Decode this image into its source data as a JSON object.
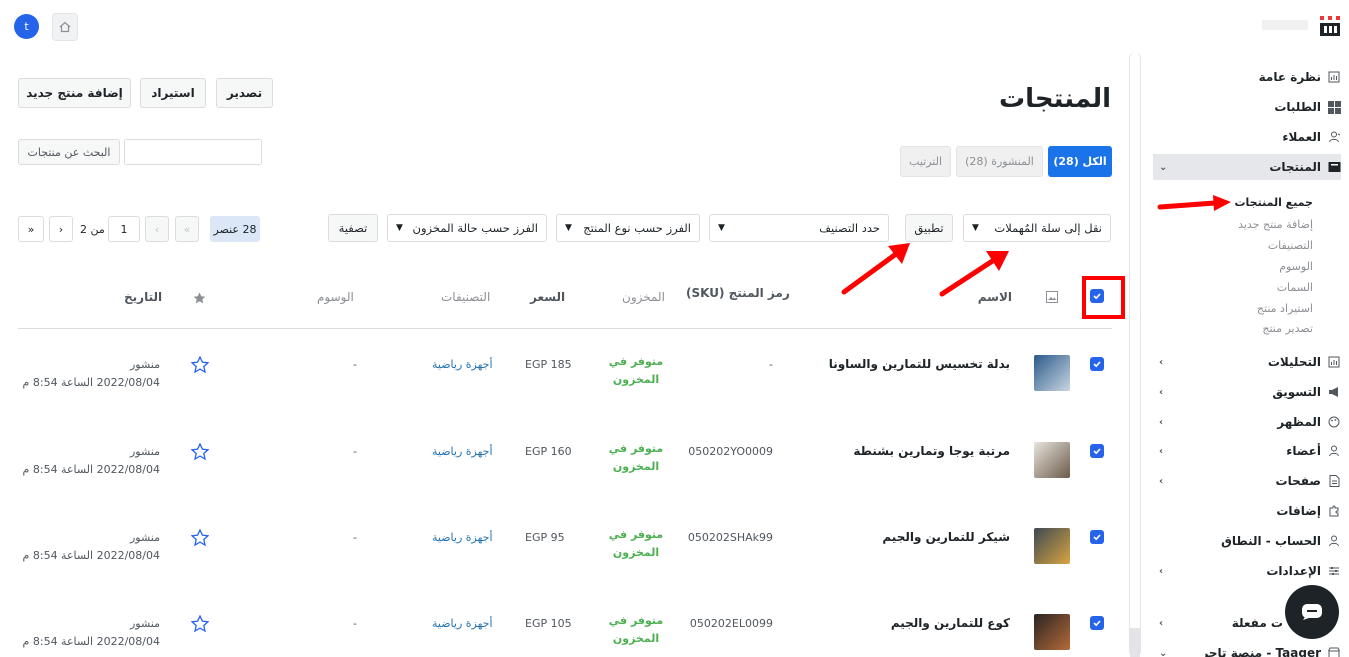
{
  "topbar": {
    "avatar_letter": "t",
    "brand_color": "#2563eb"
  },
  "sidebar": {
    "items": [
      {
        "label": "نظرة عامة",
        "icon": "chart-icon"
      },
      {
        "label": "الطلبات",
        "icon": "grid-icon"
      },
      {
        "label": "العملاء",
        "icon": "users-icon"
      },
      {
        "label": "المنتجات",
        "icon": "box-icon"
      },
      {
        "label": "التحليلات",
        "icon": "chart-icon"
      },
      {
        "label": "التسويق",
        "icon": "megaphone-icon"
      },
      {
        "label": "المظهر",
        "icon": "palette-icon"
      },
      {
        "label": "أعضاء",
        "icon": "users-icon"
      },
      {
        "label": "صفحات",
        "icon": "page-icon"
      },
      {
        "label": "إضافات",
        "icon": "puzzle-icon"
      },
      {
        "label": "الحساب - النطاق",
        "icon": "users-icon"
      },
      {
        "label": "الإعدادات",
        "icon": "sliders-icon"
      },
      {
        "label": "ت مفعلة",
        "icon": "none"
      },
      {
        "label": "Taager - منصة تاجر",
        "icon": "store-icon"
      }
    ],
    "products_submenu": [
      "جميع المنتجات",
      "إضافة منتج جديد",
      "التصنيفات",
      "الوسوم",
      "السمات",
      "استيراد منتج",
      "تصدير منتج"
    ]
  },
  "header": {
    "title": "المنتجات",
    "buttons": {
      "export": "تصدير",
      "import": "استيراد",
      "add_new": "إضافة منتج جديد"
    }
  },
  "tabs": {
    "all": "الكل (28)",
    "published": "المنشورة (28)",
    "sorting": "الترتيب"
  },
  "search": {
    "button": "البحث عن منتجات",
    "value": ""
  },
  "filters": {
    "bulk_action": "نقل إلى سلة المُهملات",
    "apply": "تطبيق",
    "category": "حدد التصنيف",
    "product_type": "الفرز حسب نوع المنتج",
    "stock_status": "الفرز حسب حالة المخزون",
    "filter_button": "تصفية"
  },
  "pagination": {
    "items_count": "28 عنصر",
    "first": "«",
    "prev": "‹",
    "current_page": "1",
    "of_pages": "من 2",
    "next": "›",
    "last": "»"
  },
  "table": {
    "columns": {
      "name": "الاسم",
      "sku": "رمز المنتج (SKU)",
      "stock": "المخزون",
      "price": "السعر",
      "categories": "التصنيفات",
      "tags": "الوسوم",
      "date": "التاريخ"
    },
    "rows": [
      {
        "name": "بدلة تخسيس للتمارين والساونا",
        "sku": "-",
        "stock": "متوفر في المخزون",
        "price": "EGP 185",
        "category": "أجهزة رياضية",
        "tags": "-",
        "status": "منشور",
        "date": "2022/08/04 الساعة 8:54 م"
      },
      {
        "name": "مرتبة يوجا وتمارين بشنطة",
        "sku": "050202YO0009",
        "stock": "متوفر في المخزون",
        "price": "EGP 160",
        "category": "أجهزة رياضية",
        "tags": "-",
        "status": "منشور",
        "date": "2022/08/04 الساعة 8:54 م"
      },
      {
        "name": "شيكر للتمارين والجيم",
        "sku": "050202SHAk99",
        "stock": "متوفر في المخزون",
        "price": "EGP 95",
        "category": "أجهزة رياضية",
        "tags": "-",
        "status": "منشور",
        "date": "2022/08/04 الساعة 8:54 م"
      },
      {
        "name": "كوع للتمارين والجيم",
        "sku": "050202EL0099",
        "stock": "متوفر في المخزون",
        "price": "EGP 105",
        "category": "أجهزة رياضية",
        "tags": "-",
        "status": "منشور",
        "date": "2022/08/04 الساعة 8:54 م"
      }
    ]
  },
  "colors": {
    "accent": "#1a73e8",
    "instock": "#4caf50",
    "annotation": "#ff0000"
  }
}
